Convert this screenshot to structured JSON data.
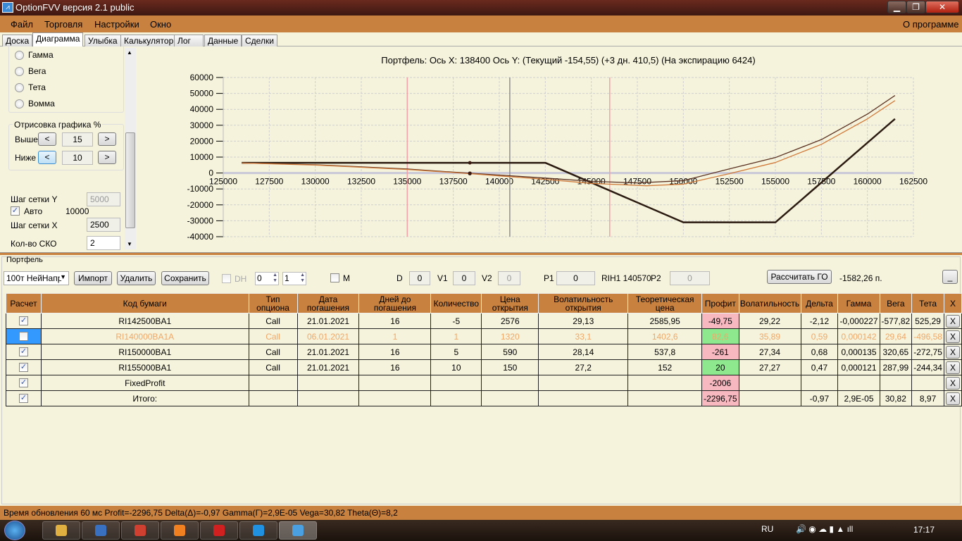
{
  "window": {
    "title": "OptionFVV версия 2.1 public",
    "icon": "chart-icon",
    "controls": [
      "minimize",
      "maximize",
      "close"
    ]
  },
  "menu": {
    "items": [
      "Файл",
      "Торговля",
      "Настройки",
      "Окно"
    ],
    "about": "О программе"
  },
  "tabs": [
    "Доска",
    "Диаграмма",
    "Улыбка",
    "Калькулятор",
    "Лог",
    "Данные",
    "Сделки"
  ],
  "active_tab": "Диаграмма",
  "left": {
    "radios": [
      "Гамма",
      "Вега",
      "Тета",
      "Вомма"
    ],
    "draw_group": {
      "title": "Отрисовка графика %",
      "above_label": "Выше",
      "above_value": "15",
      "below_label": "Ниже",
      "below_value": "10",
      "dec": "<",
      "inc": ">"
    },
    "grid_y_label": "Шаг сетки Y",
    "grid_y_value": "5000",
    "auto_label": "Авто",
    "auto_checked": true,
    "auto_value": "10000",
    "grid_x_label": "Шаг сетки X",
    "grid_x_value": "2500",
    "sko_label": "Кол-во СКО",
    "sko_value": "2"
  },
  "chart_data": {
    "type": "line",
    "title": "Портфель: Ось X: 138400 Ось Y:  (Текущий -154,55)  (+3 дн. 410,5)  (На экспирацию 6424)",
    "xlim": [
      125000,
      162500
    ],
    "ylim": [
      -40000,
      60000
    ],
    "xticks": [
      125000,
      127500,
      130000,
      132500,
      135000,
      137500,
      140000,
      142500,
      145000,
      147500,
      150000,
      152500,
      155000,
      157500,
      160000,
      162500
    ],
    "yticks": [
      60000,
      50000,
      40000,
      30000,
      20000,
      10000,
      0,
      -10000,
      -20000,
      -30000,
      -40000
    ],
    "grid": true,
    "vlines": [
      {
        "x": 135000,
        "color": "#f4a0a8"
      },
      {
        "x": 146000,
        "color": "#f4a0a8"
      },
      {
        "x": 140570,
        "color": "#909090"
      }
    ],
    "cursor_x": 138400,
    "series": [
      {
        "color": "#2a1a10",
        "x": [
          126000,
          142500,
          150000,
          155000,
          161500
        ],
        "y": [
          6424,
          6424,
          -31000,
          -31000,
          34000
        ]
      },
      {
        "color": "#5a3020",
        "x": [
          126000,
          130000,
          135000,
          138400,
          140000,
          142500,
          145000,
          147500,
          150000,
          152500,
          155000,
          157500,
          160000,
          161500
        ],
        "y": [
          6300,
          5200,
          2500,
          -155,
          -1300,
          -3200,
          -5200,
          -6200,
          -4800,
          2600,
          9700,
          21000,
          37000,
          48700
        ]
      },
      {
        "color": "#d07a3a",
        "x": [
          126000,
          130000,
          135000,
          138400,
          140000,
          142500,
          145000,
          148000,
          150000,
          152500,
          155000,
          157500,
          160000,
          161500
        ],
        "y": [
          6300,
          5000,
          2200,
          -400,
          -1800,
          -4000,
          -6500,
          -8000,
          -7000,
          -400,
          6600,
          18000,
          34000,
          45500
        ]
      }
    ]
  },
  "portfolio": {
    "title": "Портфель",
    "select": "100т НейНапр",
    "buttons": {
      "import": "Импорт",
      "delete": "Удалить",
      "save": "Сохранить",
      "calc": "Рассчитать ГО",
      "min": "_"
    },
    "dh_label": "DH",
    "spin1": "0",
    "spin2": "1",
    "m_label": "M",
    "d_label": "D",
    "d_value": "0",
    "v1_label": "V1",
    "v1_value": "0",
    "v2_label": "V2",
    "v2_value": "0",
    "p1_label": "P1",
    "p1_value": "0",
    "price_label": "RIH1 140570",
    "p2_label": "P2",
    "p2_value": "0",
    "go_value": "-1582,26 п.",
    "columns": [
      "Расчет",
      "Код бумаги",
      "Тип опциона",
      "Дата погашения",
      "Дней до погашения",
      "Количество",
      "Цена открытия",
      "Волатильность открытия",
      "Теоретическая цена",
      "Профит",
      "Волатильность",
      "Дельта",
      "Гамма",
      "Вега",
      "Тета",
      "X"
    ],
    "rows": [
      {
        "checked": true,
        "cells": [
          "RI142500BA1",
          "Call",
          "21.01.2021",
          "16",
          "-5",
          "2576",
          "29,13",
          "2585,95",
          "-49,75",
          "29,22",
          "-2,12",
          "-0,000227",
          "-577,82",
          "525,29"
        ],
        "profit": "red"
      },
      {
        "checked": false,
        "dim": true,
        "cells": [
          "RI140000BA1A",
          "Call",
          "06.01.2021",
          "1",
          "1",
          "1320",
          "33,1",
          "1402,6",
          "82,6",
          "35,89",
          "0,59",
          "0,000142",
          "29,64",
          "-496,58"
        ],
        "profit": "green"
      },
      {
        "checked": true,
        "cells": [
          "RI150000BA1",
          "Call",
          "21.01.2021",
          "16",
          "5",
          "590",
          "28,14",
          "537,8",
          "-261",
          "27,34",
          "0,68",
          "0,000135",
          "320,65",
          "-272,75"
        ],
        "profit": "red"
      },
      {
        "checked": true,
        "cells": [
          "RI155000BA1",
          "Call",
          "21.01.2021",
          "16",
          "10",
          "150",
          "27,2",
          "152",
          "20",
          "27,27",
          "0,47",
          "0,000121",
          "287,99",
          "-244,34"
        ],
        "profit": "green"
      },
      {
        "checked": true,
        "cells": [
          "FixedProfit",
          "",
          "",
          "",
          "",
          "",
          "",
          "",
          "-2006",
          "",
          "",
          "",
          "",
          ""
        ],
        "profit": "red"
      },
      {
        "checked": true,
        "cells": [
          "Итого:",
          "",
          "",
          "",
          "",
          "",
          "",
          "",
          "-2296,75",
          "",
          "-0,97",
          "2,9E-05",
          "30,82",
          "8,97"
        ],
        "profit": "red"
      }
    ],
    "delete_label": "X"
  },
  "status": "Время обновления 60 мс  Profit=-2296,75 Delta(Δ)=-0,97 Gamma(Γ)=2,9E-05 Vega=30,82 Theta(Θ)=8,2",
  "taskbar": {
    "lang": "RU",
    "time": "17:17",
    "apps": [
      "explorer",
      "remote-desktop",
      "chrome",
      "media-player",
      "yandex-browser",
      "opera",
      "optionfvv"
    ]
  }
}
